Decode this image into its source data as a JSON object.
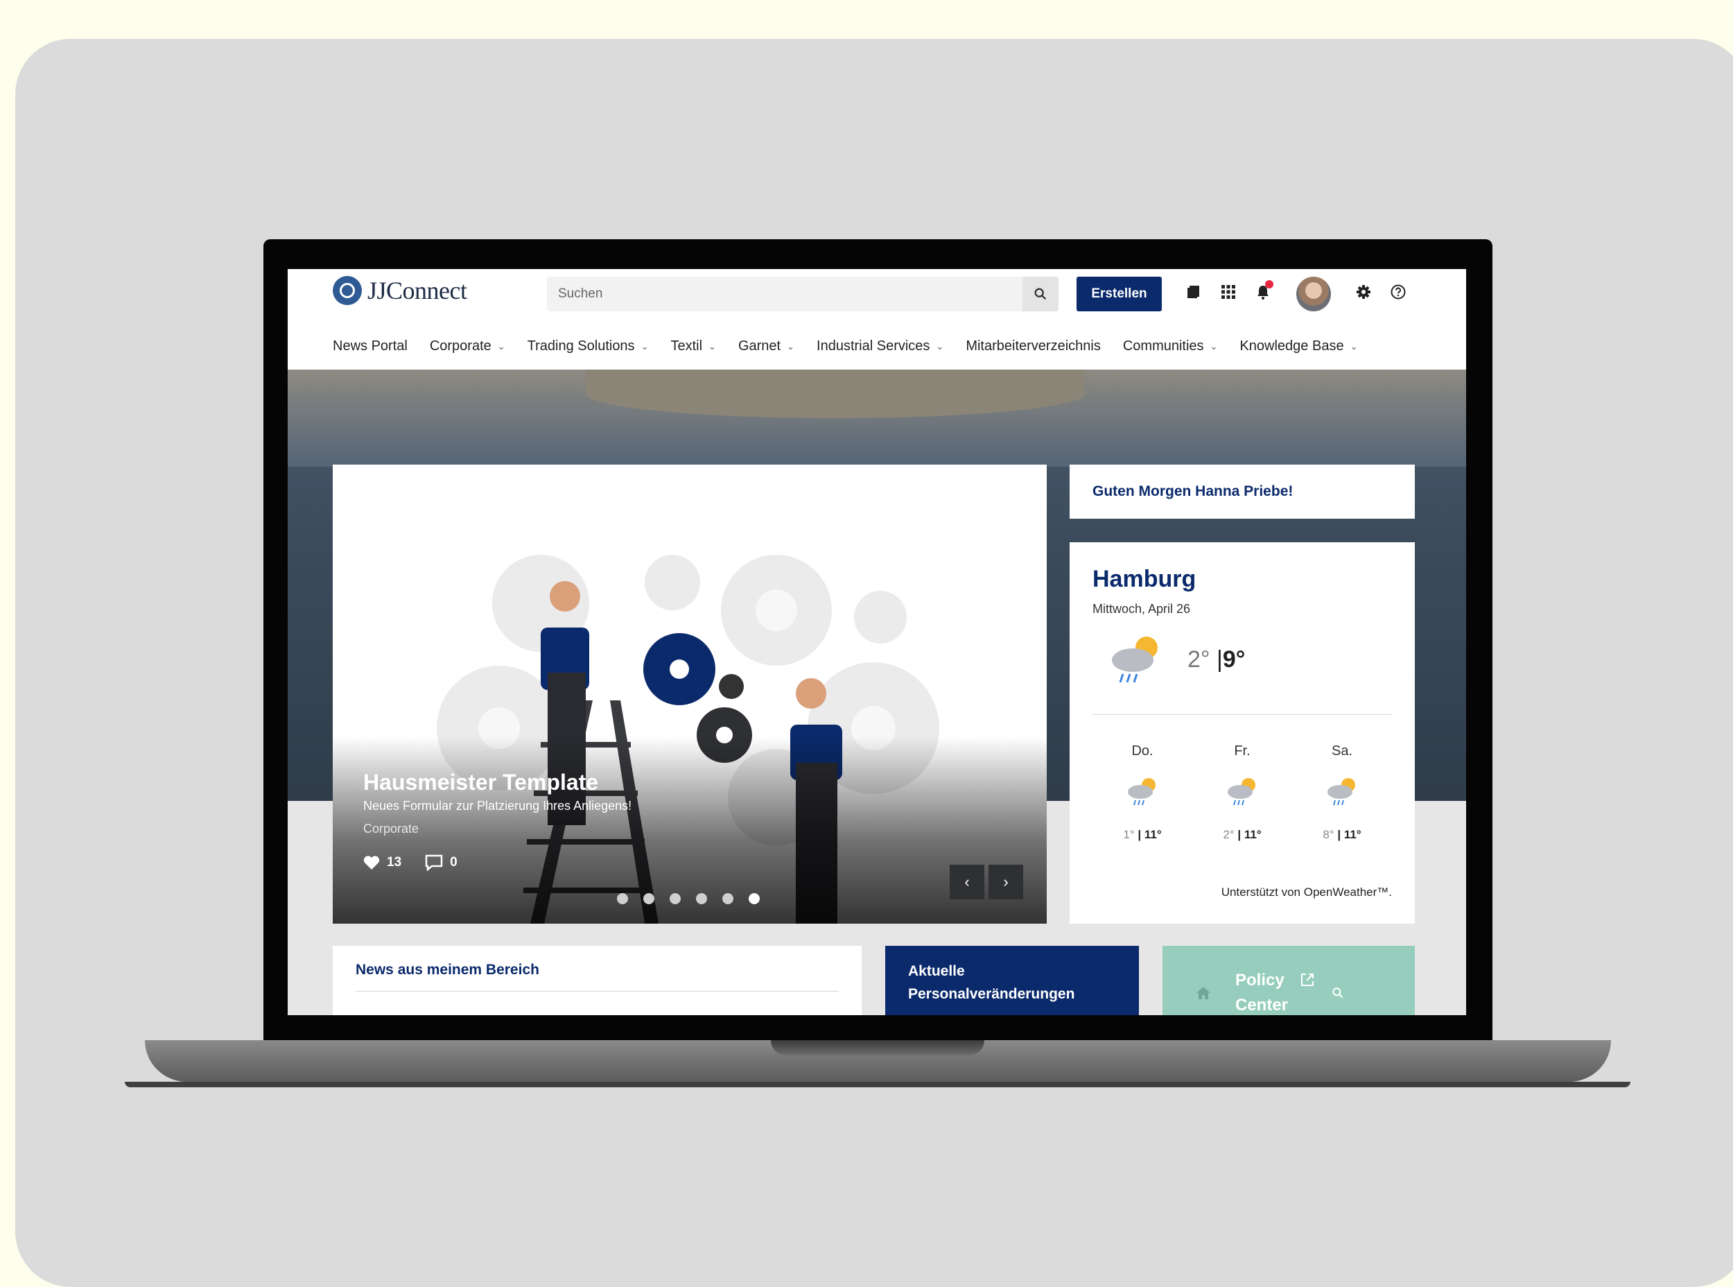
{
  "header": {
    "logo_text": "JJConnect",
    "search_placeholder": "Suchen",
    "create_label": "Erstellen"
  },
  "nav": [
    {
      "label": "News Portal",
      "has_menu": false
    },
    {
      "label": "Corporate",
      "has_menu": true
    },
    {
      "label": "Trading Solutions",
      "has_menu": true
    },
    {
      "label": "Textil",
      "has_menu": true
    },
    {
      "label": "Garnet",
      "has_menu": true
    },
    {
      "label": "Industrial Services",
      "has_menu": true
    },
    {
      "label": "Mitarbeiterverzeichnis",
      "has_menu": false
    },
    {
      "label": "Communities",
      "has_menu": true
    },
    {
      "label": "Knowledge Base",
      "has_menu": true
    }
  ],
  "slider": {
    "title": "Hausmeister Template",
    "subtitle": "Neues Formular zur Platzierung Ihres Anliegens!",
    "category": "Corporate",
    "likes": "13",
    "comments": "0",
    "dot_count": 6,
    "active_dot": 6
  },
  "greeting": "Guten Morgen Hanna Priebe!",
  "weather": {
    "city": "Hamburg",
    "date": "Mittwoch, April 26",
    "current_low": "2°",
    "current_sep": "|",
    "current_high": "9°",
    "forecast": [
      {
        "day": "Do.",
        "low": "1°",
        "high": "11°"
      },
      {
        "day": "Fr.",
        "low": "2°",
        "high": "11°"
      },
      {
        "day": "Sa.",
        "low": "8°",
        "high": "11°"
      }
    ],
    "powered_by": "Unterstützt von OpenWeather™."
  },
  "widgets": {
    "news_title": "News aus meinem Bereich",
    "personal_title": "Aktuelle Personalveränderungen",
    "policy_title": "Policy Center"
  },
  "colors": {
    "primary": "#0b2a6b",
    "policy": "#96cdbc",
    "notification": "#e5263f"
  }
}
